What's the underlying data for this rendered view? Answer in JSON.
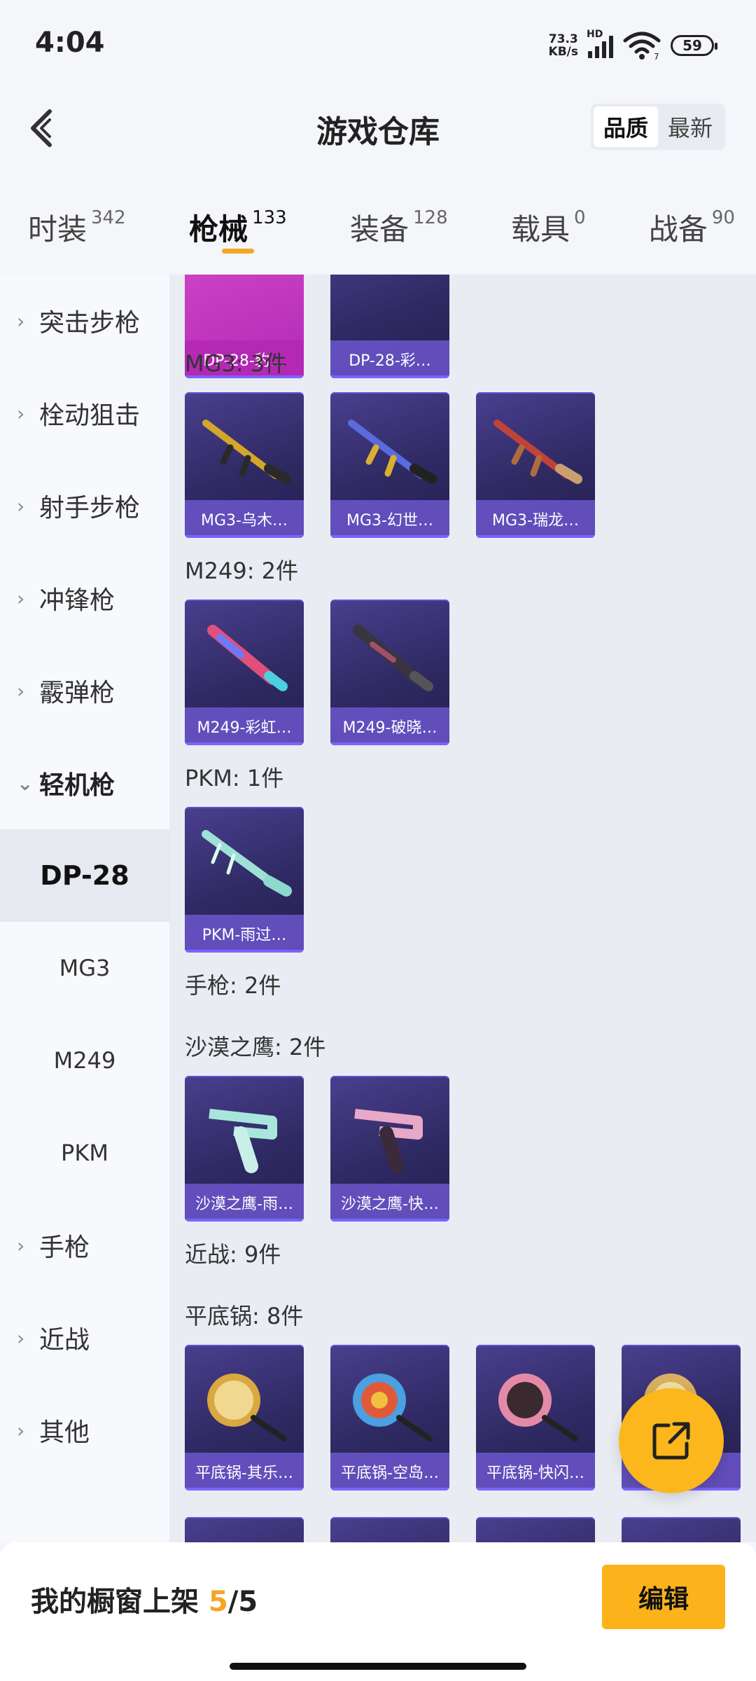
{
  "status": {
    "time": "4:04",
    "net_speed_value": "73.3",
    "net_speed_unit": "KB/s",
    "hd_label": "HD",
    "wifi_sub": "7",
    "battery": "59"
  },
  "header": {
    "title": "游戏仓库",
    "sort_quality": "品质",
    "sort_latest": "最新",
    "active_sort": "品质"
  },
  "tabs": [
    {
      "label": "时装",
      "count": "342"
    },
    {
      "label": "枪械",
      "count": "133",
      "active": true
    },
    {
      "label": "装备",
      "count": "128"
    },
    {
      "label": "载具",
      "count": "0"
    },
    {
      "label": "战备",
      "count": "90"
    }
  ],
  "sidebar": {
    "items": [
      {
        "label": "突击步枪"
      },
      {
        "label": "栓动狙击"
      },
      {
        "label": "射手步枪"
      },
      {
        "label": "冲锋枪"
      },
      {
        "label": "霰弹枪"
      },
      {
        "label": "轻机枪",
        "expanded": true
      },
      {
        "label": "手枪"
      },
      {
        "label": "近战"
      },
      {
        "label": "其他"
      }
    ],
    "subitems": [
      {
        "label": "DP-28",
        "active": true
      },
      {
        "label": "MG3"
      },
      {
        "label": "M249"
      },
      {
        "label": "PKM"
      }
    ]
  },
  "content": {
    "dp28_cards": [
      "DP-28-豹…",
      "DP-28-彩…"
    ],
    "mg3_title": "MG3: 3件",
    "mg3_cards": [
      "MG3-乌木…",
      "MG3-幻世…",
      "MG3-瑞龙…"
    ],
    "m249_title": "M249: 2件",
    "m249_cards": [
      "M249-彩虹…",
      "M249-破晓…"
    ],
    "pkm_title": "PKM: 1件",
    "pkm_cards": [
      "PKM-雨过…"
    ],
    "pistol_title": "手枪: 2件",
    "deagle_title": "沙漠之鹰: 2件",
    "deagle_cards": [
      "沙漠之鹰-雨…",
      "沙漠之鹰-快…"
    ],
    "melee_title": "近战: 9件",
    "pan_title": "平底锅: 8件",
    "pan_cards": [
      "平底锅-其乐…",
      "平底锅-空岛…",
      "平底锅-快闪…",
      "…"
    ]
  },
  "bottom": {
    "showcase_prefix": "我的橱窗上架 ",
    "showcase_current": "5",
    "showcase_total": "/5",
    "edit_label": "编辑"
  },
  "colors": {
    "accent": "#f5a623",
    "card_bg": "#2f2a63",
    "card_label": "#6c56cc"
  },
  "icons": {
    "back": "chevron-left-icon",
    "fab": "share-external-icon"
  }
}
